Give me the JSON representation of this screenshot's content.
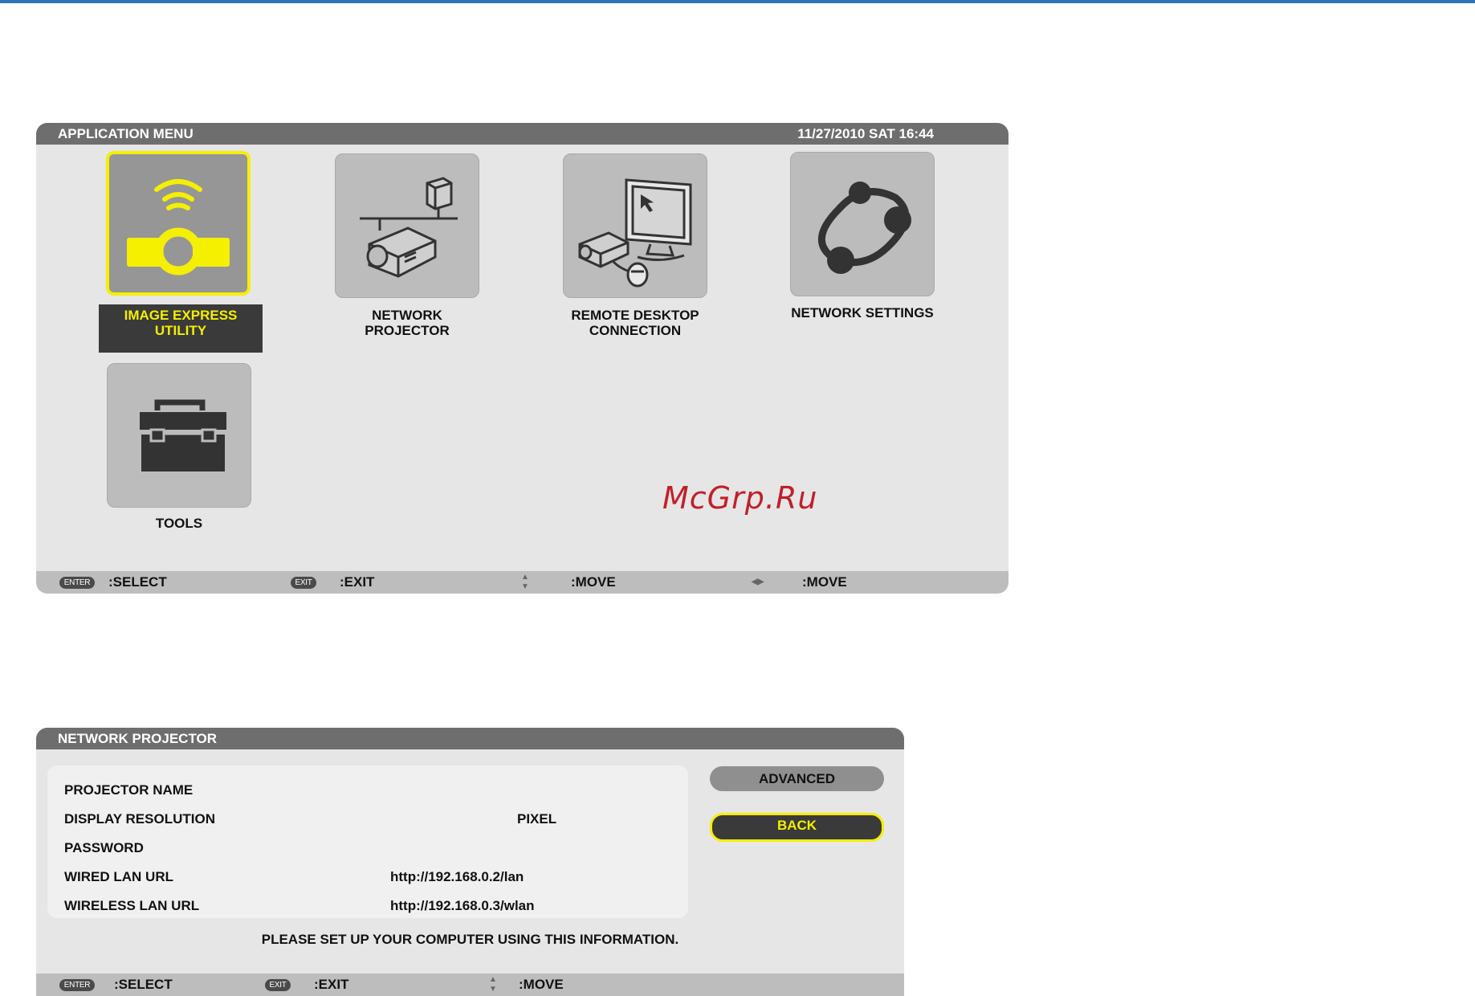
{
  "app_menu": {
    "title": "APPLICATION MENU",
    "datetime": "11/27/2010 SAT 16:44",
    "tiles": [
      {
        "label_1": "IMAGE EXPRESS",
        "label_2": "UTILITY",
        "selected": true
      },
      {
        "label_1": "NETWORK",
        "label_2": "PROJECTOR"
      },
      {
        "label_1": "REMOTE DESKTOP",
        "label_2": "CONNECTION"
      },
      {
        "label_1": "NETWORK SETTINGS"
      },
      {
        "label_1": "TOOLS"
      }
    ],
    "footer": {
      "enter_key": "ENTER",
      "select": ":SELECT",
      "exit_key": "EXIT",
      "exit": ":EXIT",
      "move_v": ":MOVE",
      "move_h": ":MOVE"
    }
  },
  "watermark": "McGrp.Ru",
  "network_projector": {
    "title": "NETWORK PROJECTOR",
    "rows": [
      {
        "label": "PROJECTOR NAME",
        "value": ""
      },
      {
        "label": "DISPLAY RESOLUTION",
        "value": "PIXEL"
      },
      {
        "label": "PASSWORD",
        "value": ""
      },
      {
        "label": "WIRED LAN URL",
        "value": "http://192.168.0.2/lan"
      },
      {
        "label": "WIRELESS LAN URL",
        "value": "http://192.168.0.3/wlan"
      }
    ],
    "buttons": {
      "advanced": "ADVANCED",
      "back": "BACK"
    },
    "notice": "PLEASE SET UP YOUR COMPUTER USING THIS INFORMATION.",
    "footer": {
      "enter_key": "ENTER",
      "select": ":SELECT",
      "exit_key": "EXIT",
      "exit": ":EXIT",
      "move_v": ":MOVE"
    }
  },
  "colors": {
    "highlight": "#f5ef00",
    "header": "#6e6e6e",
    "accent_line": "#2f74b5"
  }
}
